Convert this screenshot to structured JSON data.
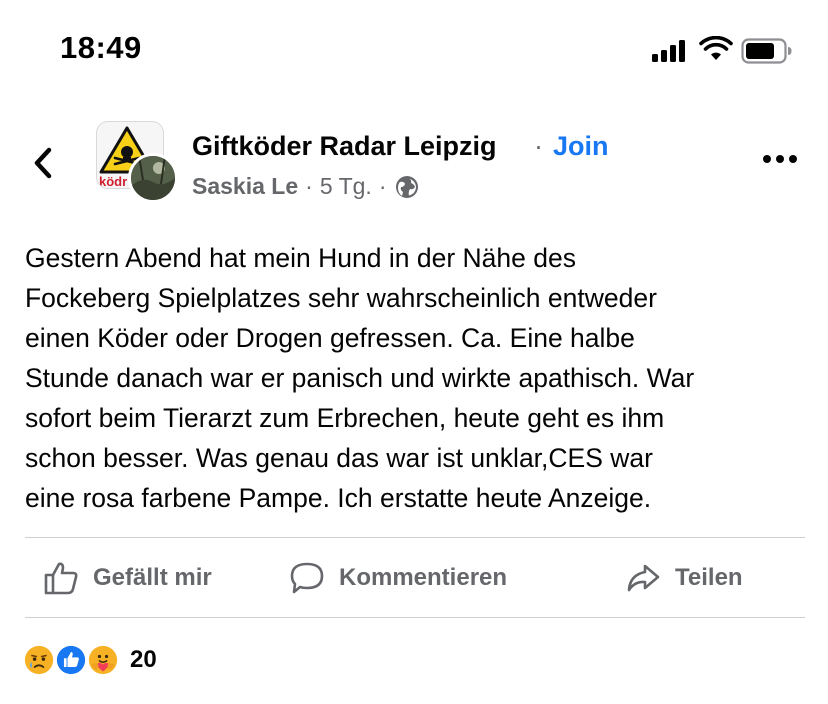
{
  "status_bar": {
    "time": "18:49",
    "icons": [
      "cellular-signal-icon",
      "wifi-icon",
      "battery-icon"
    ]
  },
  "post_header": {
    "group_name": "Giftköder Radar Leipzig",
    "separator": "·",
    "join_label": "Join",
    "author": "Saskia Le",
    "meta_sep": "·",
    "time_ago": "5 Tg.",
    "privacy_icon": "globe-icon",
    "back_icon": "chevron-left-icon",
    "more_icon": "more-options-icon"
  },
  "post": {
    "lines": [
      "Gestern Abend hat mein Hund in der Nähe des",
      "Fockeberg Spielplatzes sehr wahrscheinlich entweder",
      "einen Köder oder Drogen gefressen. Ca. Eine halbe",
      "Stunde danach war er panisch und wirkte apathisch. War",
      "sofort beim Tierarzt zum Erbrechen, heute geht es ihm",
      "schon besser. Was genau das war ist unklar,CES war",
      "eine rosa farbene Pampe. Ich erstatte heute Anzeige."
    ]
  },
  "actions": {
    "like_label": "Gefällt mir",
    "comment_label": "Kommentieren",
    "share_label": "Teilen"
  },
  "reactions": {
    "icons": [
      "sad-reaction-icon",
      "like-reaction-icon",
      "care-reaction-icon"
    ],
    "count": "20"
  },
  "colors": {
    "link_blue": "#1877f2",
    "secondary_text": "#65676b",
    "primary_text": "#050505",
    "divider": "#ced0d4",
    "like_blue": "#1877f2",
    "reaction_yellow": "#f7b125"
  }
}
